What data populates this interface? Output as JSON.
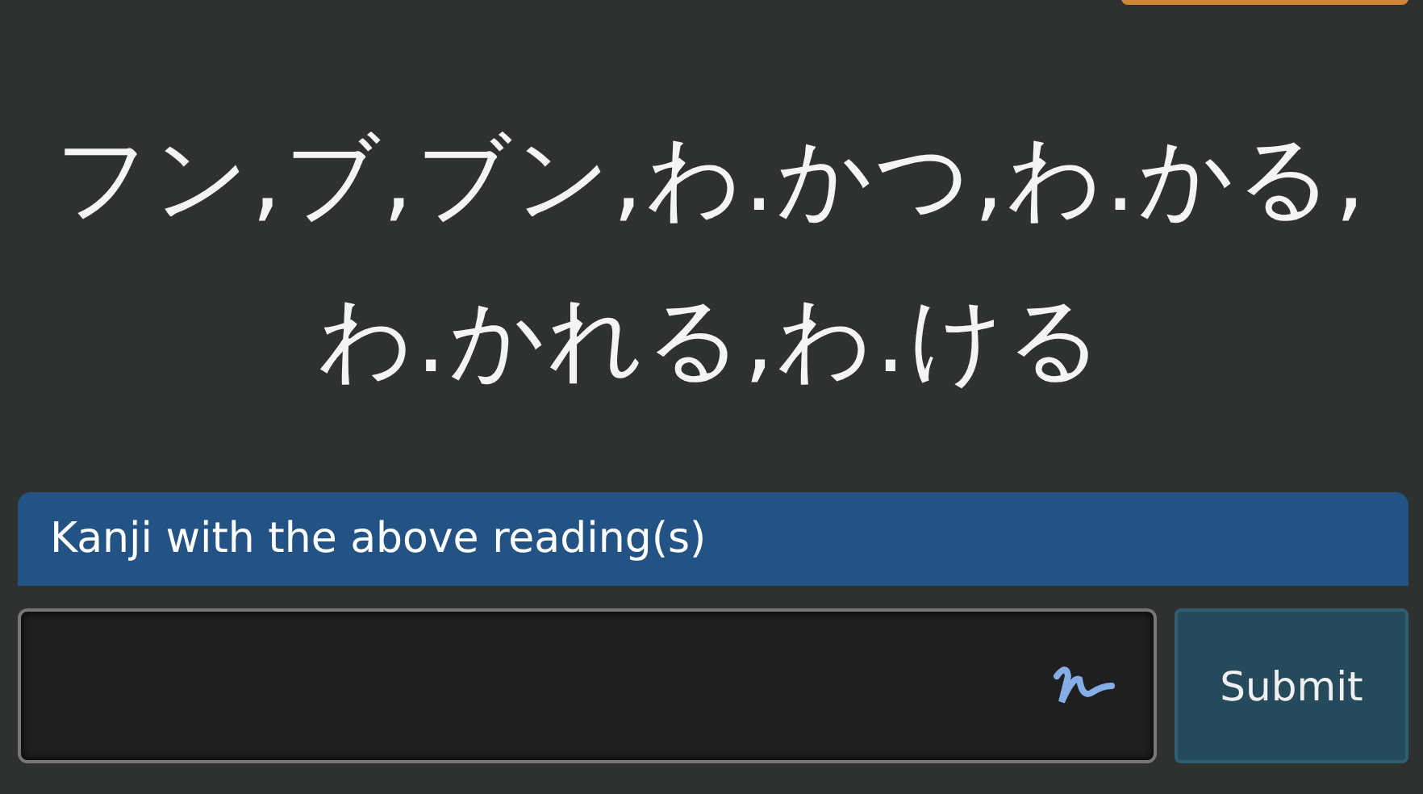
{
  "reading": "フン,ブ,ブン,わ.かつ,わ.かる,わ.かれる,わ.ける",
  "prompt": "Kanji with the above reading(s)",
  "submit": "Submit"
}
